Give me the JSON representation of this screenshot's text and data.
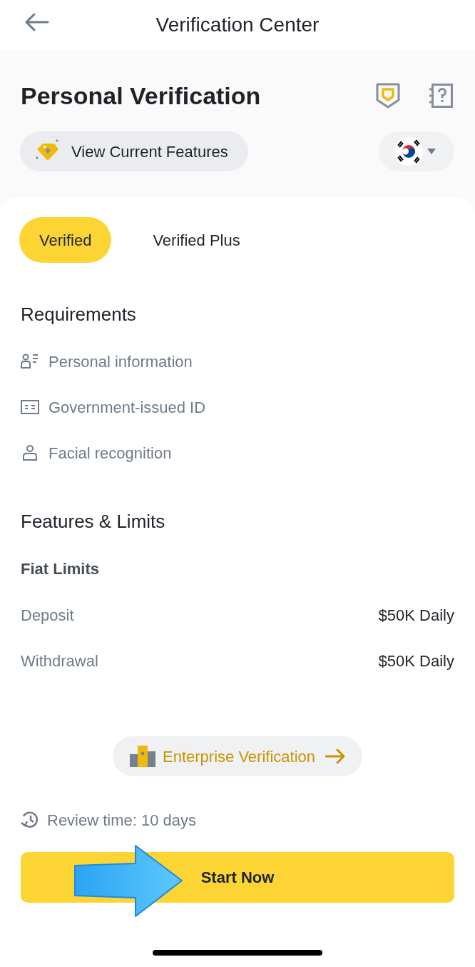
{
  "header": {
    "title": "Verification Center"
  },
  "page": {
    "title": "Personal Verification"
  },
  "features_button": {
    "label": "View Current Features"
  },
  "tabs": [
    {
      "label": "Verified",
      "selected": true
    },
    {
      "label": "Verified Plus",
      "selected": false
    }
  ],
  "requirements": {
    "title": "Requirements",
    "items": [
      {
        "kind": "profile",
        "label": "Personal information"
      },
      {
        "kind": "id-card",
        "label": "Government-issued ID"
      },
      {
        "kind": "person",
        "label": "Facial recognition"
      }
    ]
  },
  "features": {
    "title": "Features & Limits",
    "groups": [
      {
        "title": "Fiat Limits",
        "rows": [
          {
            "label": "Deposit",
            "value": "$50K Daily"
          },
          {
            "label": "Withdrawal",
            "value": "$50K Daily"
          }
        ]
      }
    ]
  },
  "enterprise_button": {
    "label": "Enterprise Verification"
  },
  "review_time": "Review time: 10 days",
  "start_button": {
    "label": "Start Now"
  }
}
